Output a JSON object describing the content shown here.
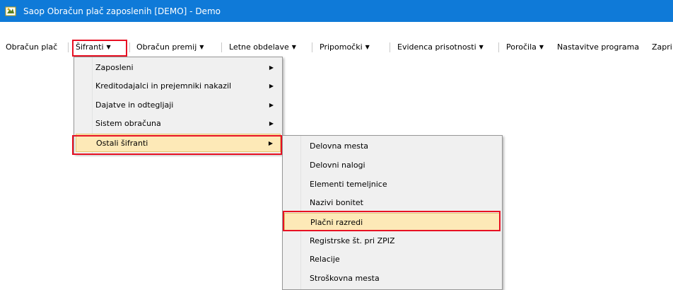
{
  "window": {
    "title": "Saop Obračun plač zaposlenih  [DEMO] - Demo",
    "icon": "app-logo-icon"
  },
  "menubar": {
    "items": [
      {
        "label": "Obračun plač",
        "dropdown": false
      },
      {
        "label": "Šifranti",
        "dropdown": true,
        "highlighted": true
      },
      {
        "label": "Obračun premij",
        "dropdown": true
      },
      {
        "label": "Letne obdelave",
        "dropdown": true
      },
      {
        "label": "Pripomočki",
        "dropdown": true
      },
      {
        "label": "Evidenca prisotnosti",
        "dropdown": true
      },
      {
        "label": "Poročila",
        "dropdown": true
      },
      {
        "label": "Nastavitve programa",
        "dropdown": false
      },
      {
        "label": "Zapri",
        "dropdown": false
      }
    ],
    "arrow_glyph": "▼"
  },
  "sifranti_menu": {
    "items": [
      {
        "label": "Zaposleni",
        "submenu": true
      },
      {
        "label": "Kreditodajalci in prejemniki nakazil",
        "submenu": true
      },
      {
        "label": "Dajatve in odtegljaji",
        "submenu": true
      },
      {
        "label": "Sistem obračuna",
        "submenu": true
      },
      {
        "label": "Ostali šifranti",
        "submenu": true,
        "active": true
      }
    ],
    "submenu_glyph": "▶"
  },
  "ostali_menu": {
    "items": [
      {
        "label": "Delovna mesta"
      },
      {
        "label": "Delovni nalogi"
      },
      {
        "label": "Elementi temeljnice"
      },
      {
        "label": "Nazivi bonitet"
      },
      {
        "label": "Plačni razredi",
        "active": true
      },
      {
        "label": "Registrske št. pri ZPIZ"
      },
      {
        "label": "Relacije"
      },
      {
        "label": "Stroškovna mesta"
      }
    ]
  },
  "colors": {
    "titlebar": "#0f7ad8",
    "highlight_outline": "#e81123",
    "active_item": "#fde9b7",
    "menu_background": "#f0f0f0"
  }
}
